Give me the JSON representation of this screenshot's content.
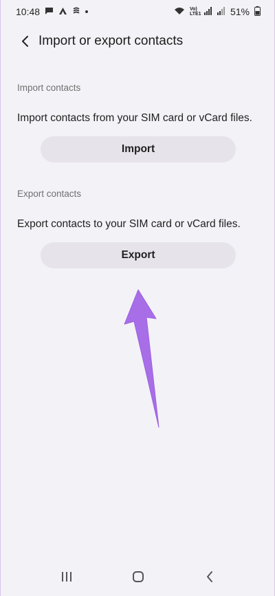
{
  "status_bar": {
    "time": "10:48",
    "lte_label": "Vo) LTE1",
    "battery": "51%",
    "icons": [
      "message-icon",
      "arrow-app-icon",
      "sync-icon",
      "notification-dot",
      "wifi-icon",
      "signal-icon",
      "signal-icon-2",
      "battery-icon"
    ]
  },
  "header": {
    "title": "Import or export contacts",
    "back_icon": "chevron-left-icon"
  },
  "import_section": {
    "label": "Import contacts",
    "description": "Import contacts from your SIM card or vCard files.",
    "button_label": "Import"
  },
  "export_section": {
    "label": "Export contacts",
    "description": "Export contacts to your SIM card or vCard files.",
    "button_label": "Export"
  },
  "annotation": {
    "arrow_icon": "annotation-arrow",
    "color": "#a86ee8"
  },
  "nav_bar": {
    "icons": [
      "recent-apps-icon",
      "home-icon",
      "back-icon"
    ]
  },
  "colors": {
    "background": "#f3f2f7",
    "button_bg": "#e6e4ea",
    "section_label": "#707070"
  }
}
